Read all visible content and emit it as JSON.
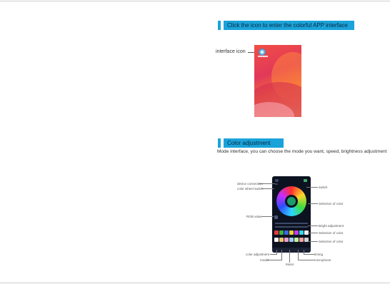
{
  "sections": [
    {
      "title": "Click the icon to enter the colorful APP interface"
    },
    {
      "title": "Color adjustment"
    }
  ],
  "figure1": {
    "pointer_label": "interface icon"
  },
  "mode_description": "Mode interface, you can choose the mode you want, speed, brightness adjustment",
  "app_callouts": {
    "device_connection": "device connection",
    "color_wheel_switch": "color wheel switch",
    "rgb_value": "RGB value",
    "color_adjustment": "color adjustment",
    "model": "model",
    "music": "Music",
    "switch": "switch",
    "selection_of_color_1": "Selection of color",
    "bright_adjustment": "Bright adjustment",
    "selection_of_color_2": "Selection of color",
    "selection_of_color_3": "Selection of color",
    "timing": "timing",
    "microphone": "microphone"
  },
  "colors": {
    "accent": "#1aa3d9"
  }
}
